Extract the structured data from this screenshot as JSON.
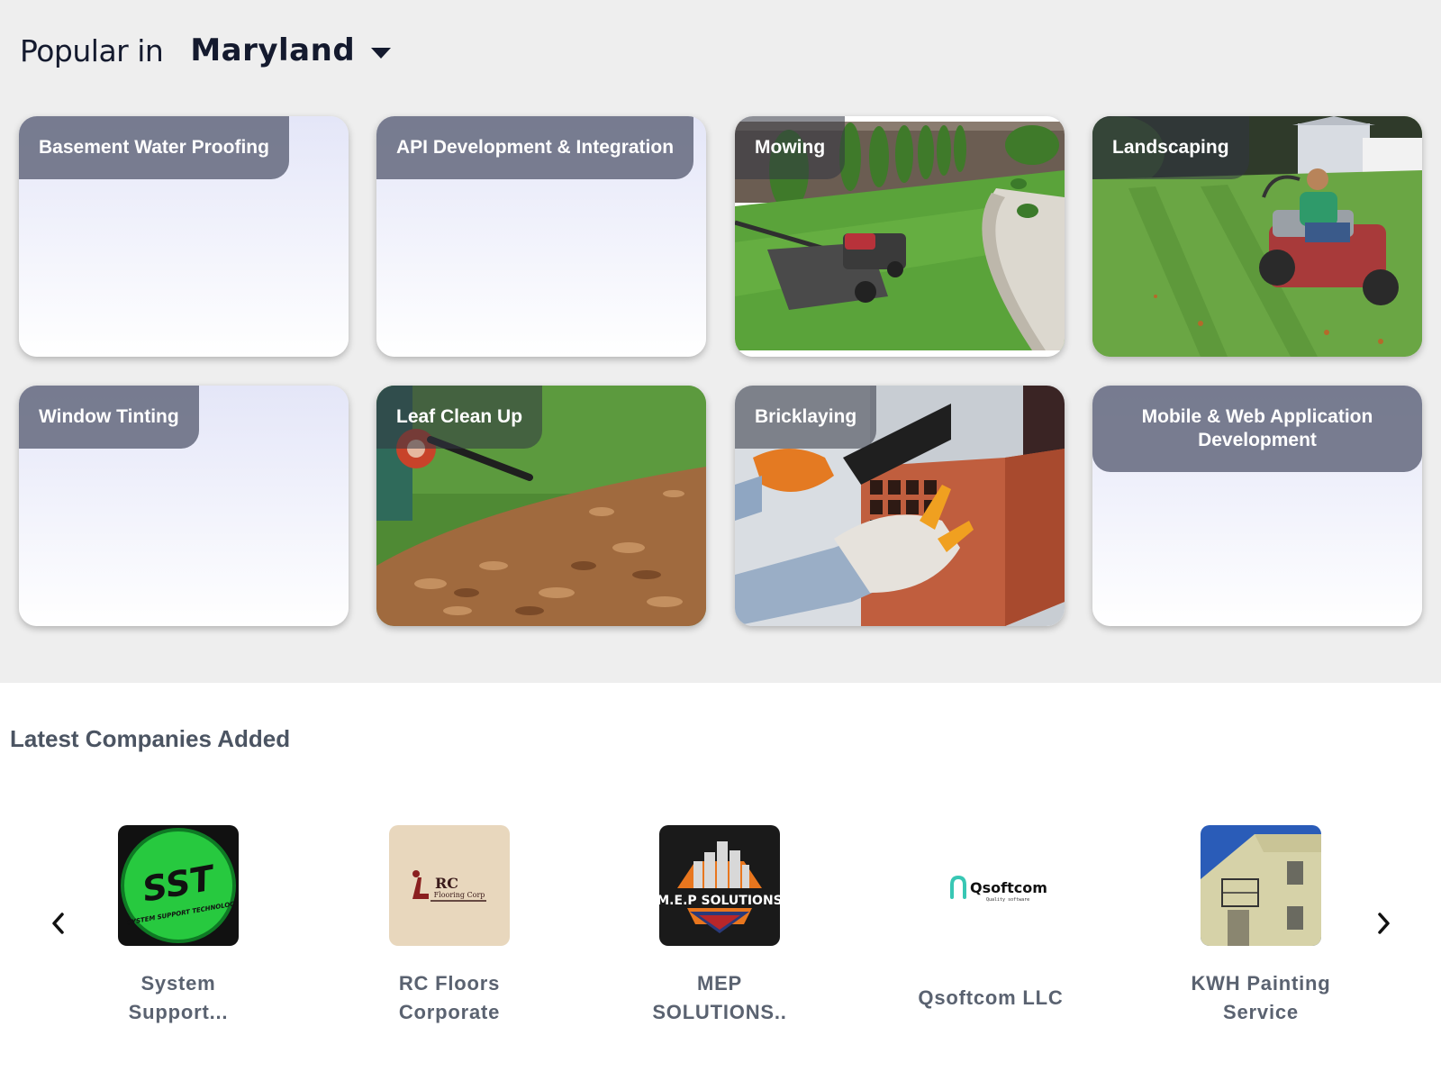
{
  "popular": {
    "prefix": "Popular in",
    "region": "Maryland",
    "cards": [
      {
        "label": "Basement Water Proofing"
      },
      {
        "label": "API Development & Integration"
      },
      {
        "label": "Mowing"
      },
      {
        "label": "Landscaping"
      },
      {
        "label": "Window Tinting"
      },
      {
        "label": "Leaf Clean Up"
      },
      {
        "label": "Bricklaying"
      },
      {
        "label": "Mobile & Web Application Development"
      }
    ]
  },
  "latest": {
    "title": "Latest Companies Added",
    "companies": [
      {
        "name": "System Support...",
        "logo_text": "SST",
        "logo_subtext": "SYSTEM SUPPORT TECHNOLOGY"
      },
      {
        "name": "RC Floors Corporate",
        "logo_text": "RC",
        "logo_subtext": "Flooring Corp"
      },
      {
        "name": "MEP SOLUTIONS..",
        "logo_text": "M.E.P SOLUTIONS"
      },
      {
        "name": "Qsoftcom LLC",
        "logo_text": "Qsoftcom",
        "logo_subtext": "Quality software"
      },
      {
        "name": "KWH Painting Service"
      }
    ]
  },
  "icons": {
    "prev": "chevron-left-icon",
    "next": "chevron-right-icon",
    "dropdown": "caret-down-icon"
  }
}
